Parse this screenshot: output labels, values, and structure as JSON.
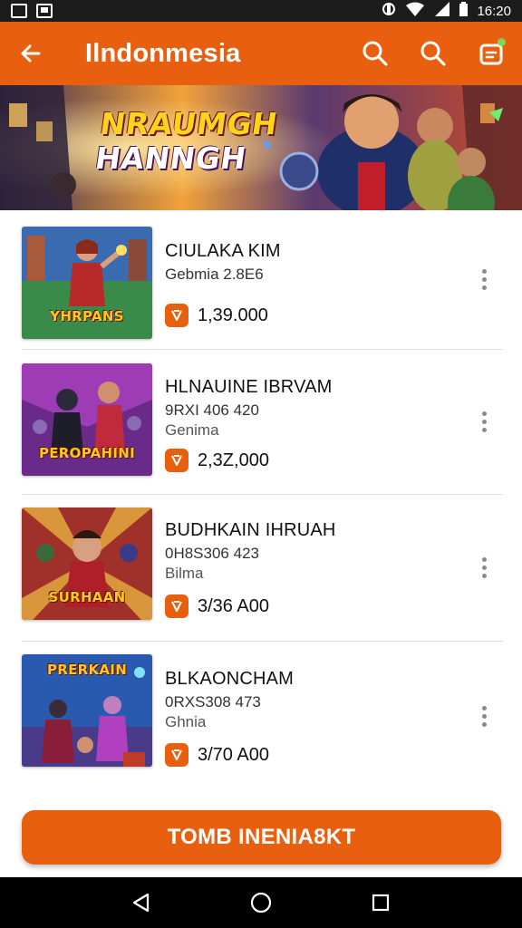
{
  "status_bar": {
    "time": "16:20",
    "left_icons": [
      "image-icon",
      "message-icon"
    ],
    "right_icons": [
      "vibrate-icon",
      "wifi-icon",
      "signal-icon",
      "battery-icon"
    ]
  },
  "app_bar": {
    "title": "Ilndonmesia",
    "back_icon": "arrow-left-icon",
    "actions": [
      "search-icon",
      "search-icon",
      "notification-icon"
    ]
  },
  "banner": {
    "line1": "NRAUMGH",
    "line2": "HANNGH"
  },
  "games": [
    {
      "title": "CIULAKA KIM",
      "subtitle": "Gebmia 2.8E6",
      "subtitle2": "",
      "price": "1,39.000",
      "thumb_label": "YHRPANS"
    },
    {
      "title": "HLNAUINE IBRVAM",
      "subtitle": "9RXI 406 420",
      "subtitle2": "Genima",
      "price": "2,3Z,000",
      "thumb_label": "PEROPAHINI"
    },
    {
      "title": "BUDHKAIN IHRUAH",
      "subtitle": "0H8S306 423",
      "subtitle2": "Bilma",
      "price": "3/36 A00",
      "thumb_label": "SURHAAN"
    },
    {
      "title": "BLKAONCHAM",
      "subtitle": "0RXS308 473",
      "subtitle2": "Ghnia",
      "price": "3/70 A00",
      "thumb_label": "PRERKAIN"
    }
  ],
  "cta": {
    "label": "TOMB INENIA8KT"
  },
  "nav_bar": {
    "buttons": [
      "back-triangle-icon",
      "home-circle-icon",
      "recents-square-icon"
    ]
  },
  "colors": {
    "accent": "#e8600f",
    "status_bar": "#1c1c1c",
    "nav_bar": "#000000"
  }
}
